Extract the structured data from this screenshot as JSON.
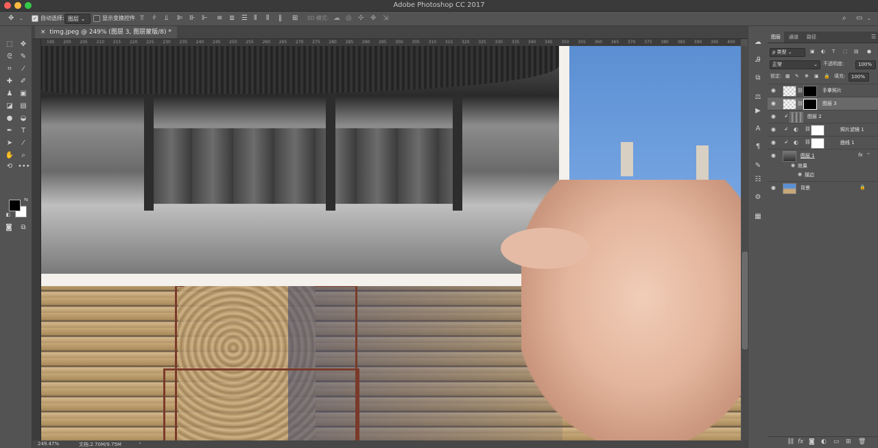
{
  "window": {
    "title": "Adobe Photoshop CC 2017"
  },
  "options_bar": {
    "auto_select_label": "自动选择:",
    "auto_select_target": "图层",
    "show_transform_label": "显示变换控件",
    "mode_3d_label": "3D 模式:"
  },
  "document": {
    "tab_title": "timg.jpeg @ 249% (图层 3, 图层蒙版/8) *",
    "ruler_ticks": [
      "195",
      "200",
      "205",
      "210",
      "215",
      "220",
      "225",
      "230",
      "235",
      "240",
      "245",
      "250",
      "255",
      "260",
      "265",
      "270",
      "275",
      "280",
      "285",
      "290",
      "295",
      "300",
      "305",
      "310",
      "315",
      "320",
      "325",
      "330",
      "335",
      "340",
      "345",
      "350",
      "355",
      "360",
      "365",
      "370",
      "375",
      "380",
      "385",
      "390",
      "395",
      "400"
    ]
  },
  "status": {
    "zoom": "249.47%",
    "doc_size": "文档:2.70M/9.75M",
    "arrow": "›"
  },
  "colors": {
    "panel_bg": "#535353",
    "selected_layer": "#696969",
    "fg": "#000000",
    "bg": "#ffffff"
  },
  "layers_panel": {
    "tabs": [
      "图层",
      "通道",
      "路径"
    ],
    "filter_kind": "ρ 类型",
    "blend_mode": "正常",
    "opacity_label": "不透明度:",
    "opacity_value": "100%",
    "lock_label": "锁定:",
    "fill_label": "填充:",
    "fill_value": "100%",
    "layers": [
      {
        "name": "手拿照片",
        "icon": "link-icon"
      },
      {
        "name": "图层 3",
        "icon": "link-icon"
      },
      {
        "name": "图层 2",
        "icon": "clip-icon"
      },
      {
        "name": "照片滤镜 1",
        "icon": "adjustment-icon"
      },
      {
        "name": "曲线 1",
        "icon": "adjustment-icon"
      },
      {
        "name": "图层 1",
        "fx": "fx"
      },
      {
        "name": "效果"
      },
      {
        "name": "描边"
      },
      {
        "name": "背景"
      }
    ]
  }
}
